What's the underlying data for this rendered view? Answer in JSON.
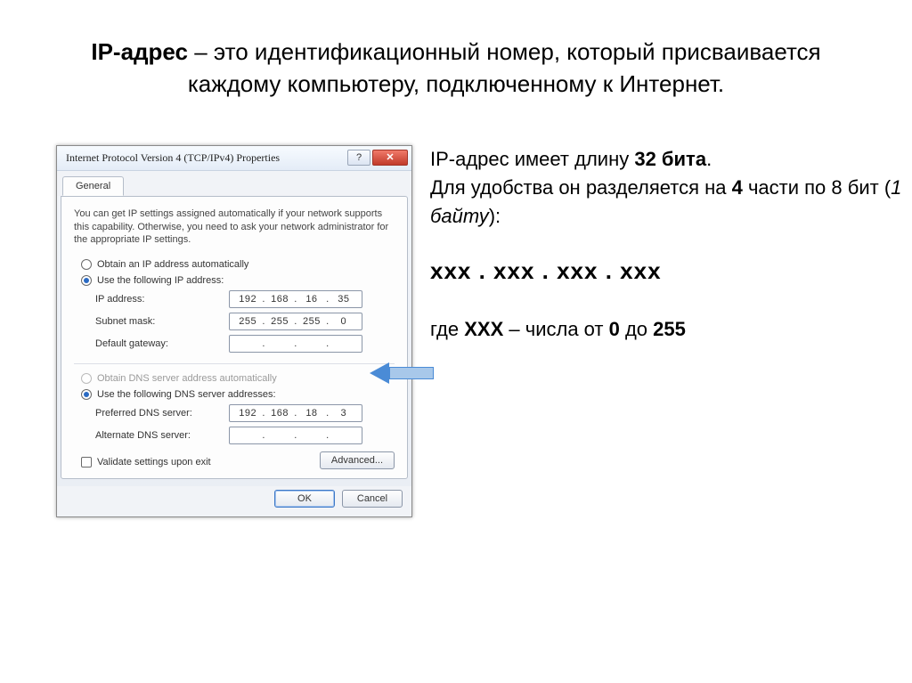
{
  "title": {
    "term": "IP-адрес",
    "rest": " – это идентификационный номер, который присваивается каждому компьютеру, подключенному к Интернет."
  },
  "explain": {
    "line1_a": "IP-адрес имеет длину ",
    "line1_b": "32 бита",
    "line1_c": ".",
    "line2_a": "Для удобства он разделяется на ",
    "line2_b": "4",
    "line2_c": " части по 8 бит (",
    "line2_d": "1 байту",
    "line2_e": "):",
    "pattern": "ххх . ххх . ххх . ххх",
    "range_a": "где ",
    "range_b": "ХХХ",
    "range_c": " – числа от ",
    "range_d": "0",
    "range_e": " до ",
    "range_f": "255"
  },
  "dialog": {
    "title": "Internet Protocol Version 4 (TCP/IPv4) Properties",
    "tab": "General",
    "description": "You can get IP settings assigned automatically if your network supports this capability. Otherwise, you need to ask your network administrator for the appropriate IP settings.",
    "radio_auto_ip": "Obtain an IP address automatically",
    "radio_static_ip": "Use the following IP address:",
    "lbl_ip": "IP address:",
    "lbl_mask": "Subnet mask:",
    "lbl_gw": "Default gateway:",
    "radio_auto_dns": "Obtain DNS server address automatically",
    "radio_static_dns": "Use the following DNS server addresses:",
    "lbl_pdns": "Preferred DNS server:",
    "lbl_adns": "Alternate DNS server:",
    "validate": "Validate settings upon exit",
    "advanced": "Advanced...",
    "ok": "OK",
    "cancel": "Cancel",
    "ip": {
      "a": "192",
      "b": "168",
      "c": "16",
      "d": "35"
    },
    "mask": {
      "a": "255",
      "b": "255",
      "c": "255",
      "d": "0"
    },
    "gw": {
      "a": "",
      "b": "",
      "c": "",
      "d": ""
    },
    "pdns": {
      "a": "192",
      "b": "168",
      "c": "18",
      "d": "3"
    },
    "adns": {
      "a": "",
      "b": "",
      "c": "",
      "d": ""
    }
  }
}
